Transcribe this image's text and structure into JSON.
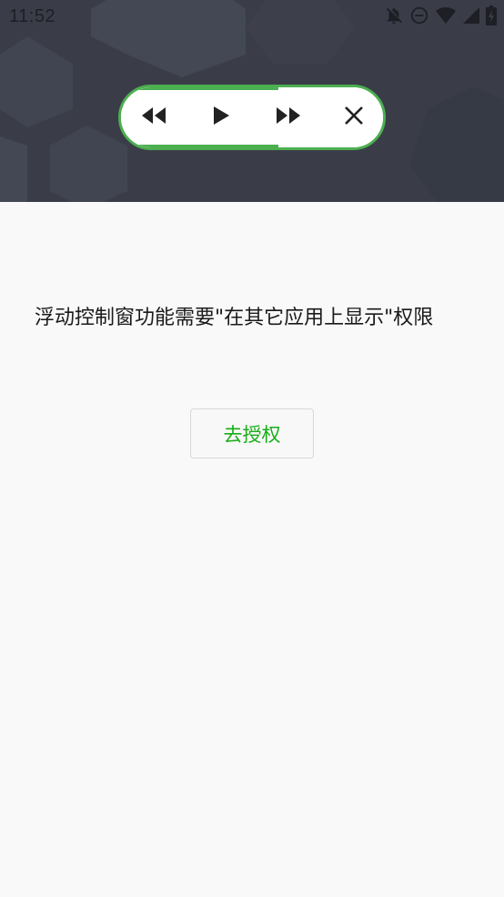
{
  "status_bar": {
    "time": "11:52",
    "icons": [
      "notifications-off-icon",
      "do-not-disturb-icon",
      "wifi-icon",
      "cellular-signal-icon",
      "battery-charging-icon"
    ]
  },
  "floating_player": {
    "progress": 0.6,
    "accent_color": "#4caf50",
    "controls": [
      "rewind-icon",
      "play-icon",
      "fast-forward-icon",
      "close-icon"
    ]
  },
  "permission": {
    "message": "浮动控制窗功能需要\"在其它应用上显示\"权限",
    "grant_button": "去授权",
    "grant_color": "#1aad19"
  }
}
